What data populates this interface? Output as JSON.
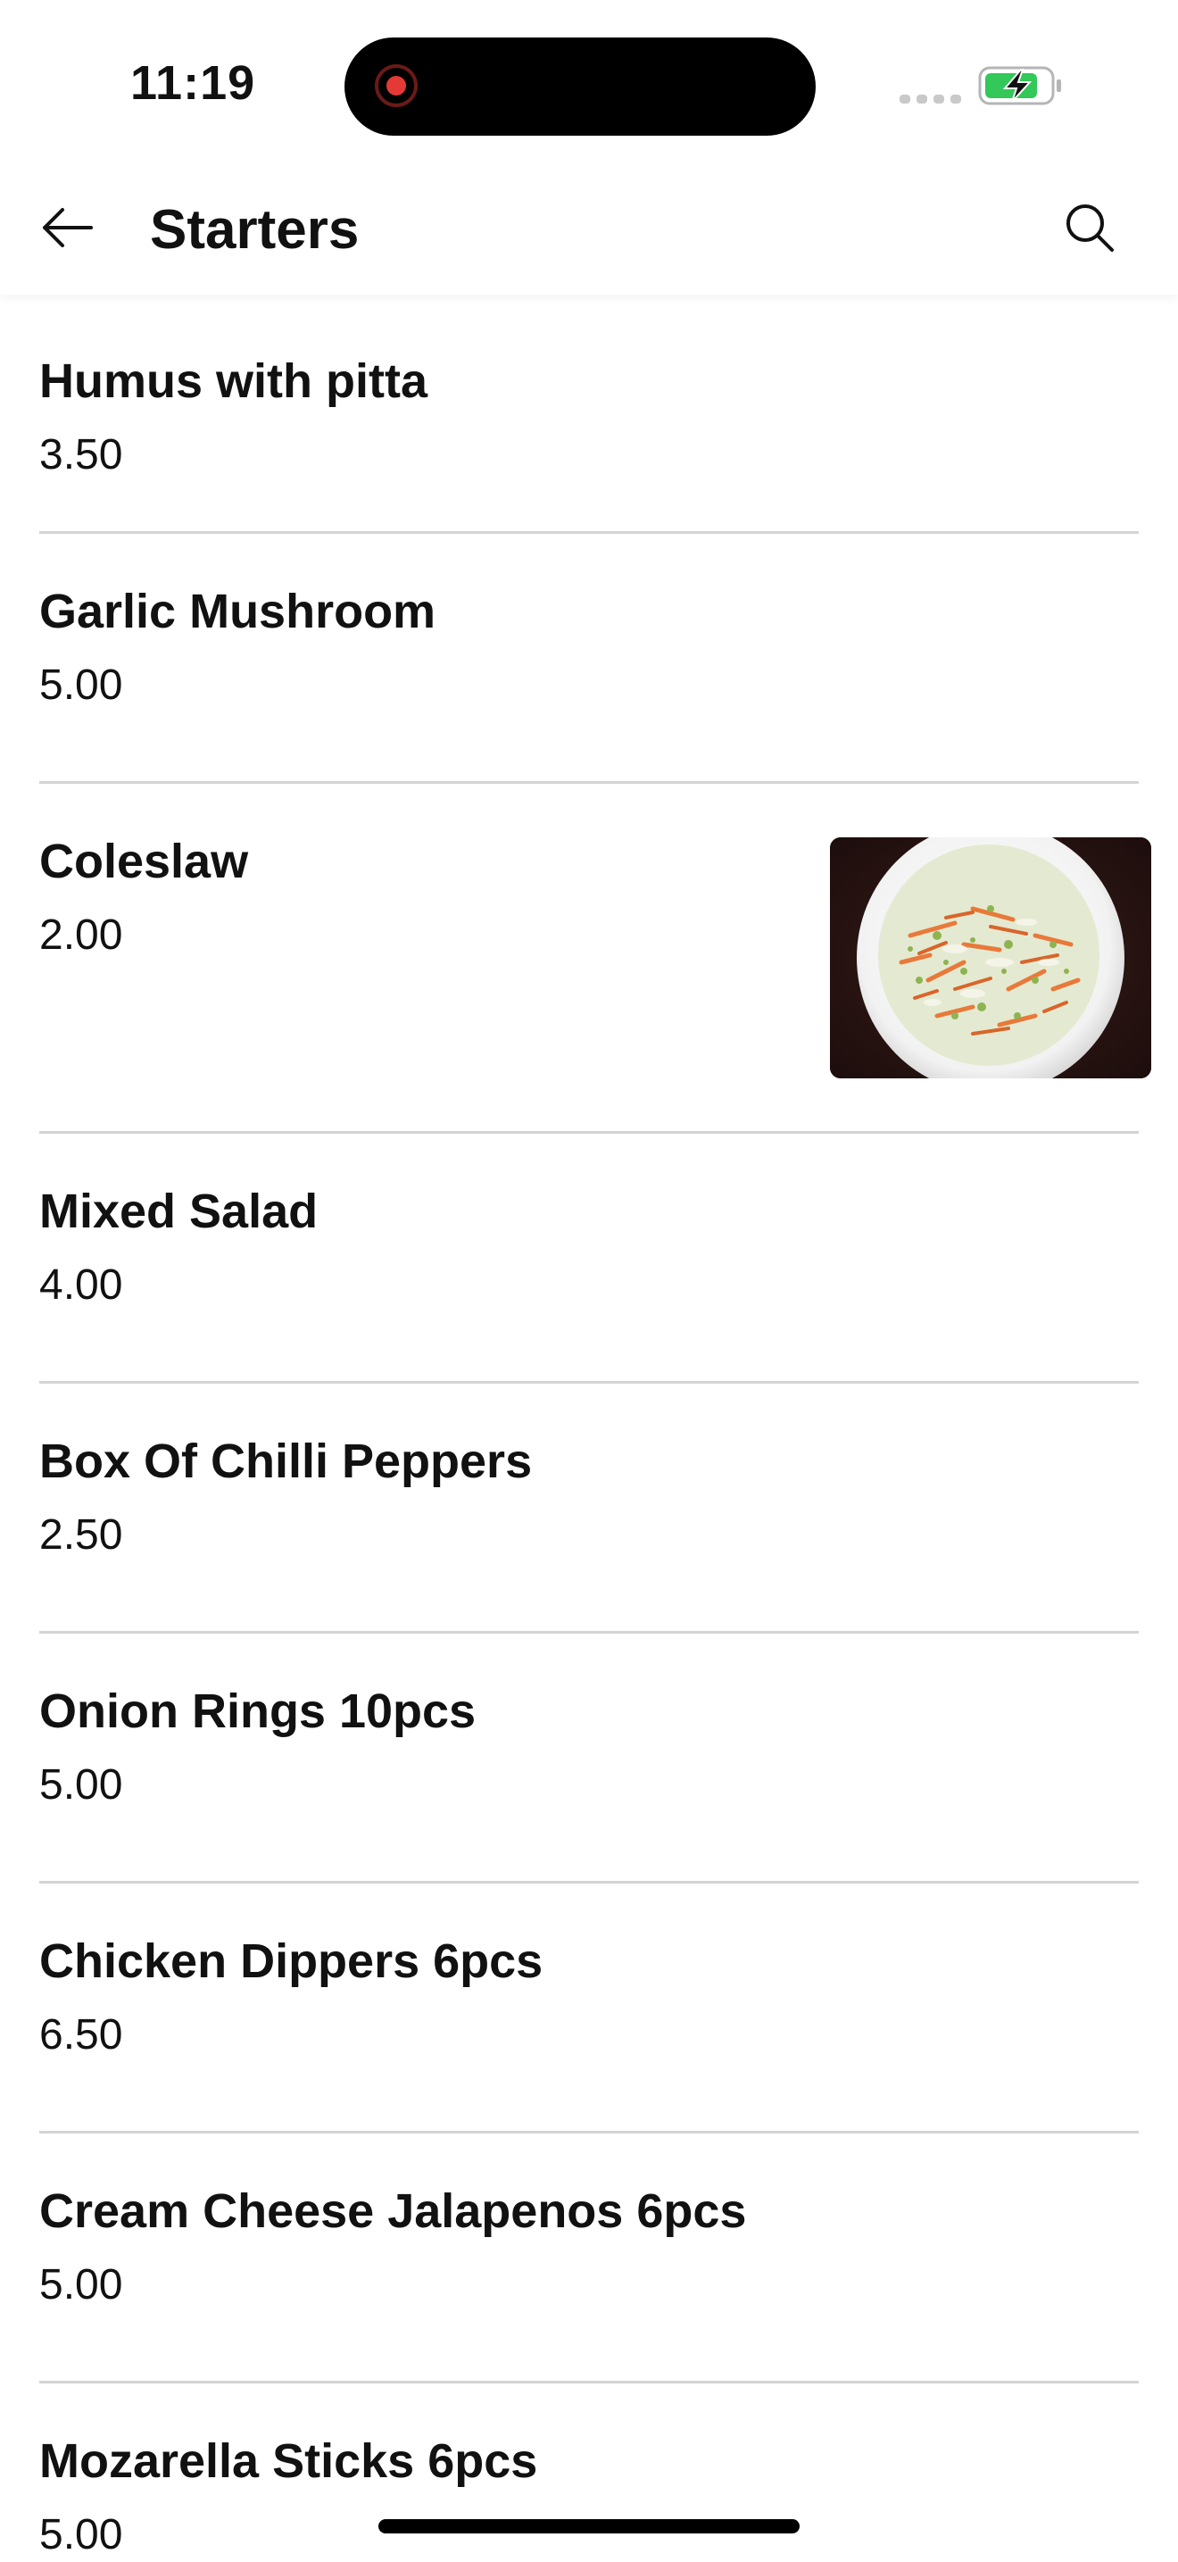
{
  "status_bar": {
    "time": "11:19",
    "colors": {
      "record": "#e53935",
      "battery_fill": "#34c759"
    }
  },
  "header": {
    "title": "Starters",
    "back_icon": "arrow-left-icon",
    "search_icon": "search-icon"
  },
  "menu_items": [
    {
      "name": "Humus with pitta",
      "price": "3.50"
    },
    {
      "name": "Garlic Mushroom",
      "price": "5.00"
    },
    {
      "name": "Coleslaw",
      "price": "2.00",
      "photo": "coleslaw-photo"
    },
    {
      "name": "Mixed Salad",
      "price": "4.00"
    },
    {
      "name": "Box Of Chilli Peppers",
      "price": "2.50"
    },
    {
      "name": "Onion Rings 10pcs",
      "price": "5.00"
    },
    {
      "name": "Chicken Dippers 6pcs",
      "price": "6.50"
    },
    {
      "name": "Cream Cheese Jalapenos 6pcs",
      "price": "5.00"
    },
    {
      "name": "Mozarella Sticks 6pcs",
      "price": "5.00"
    }
  ]
}
